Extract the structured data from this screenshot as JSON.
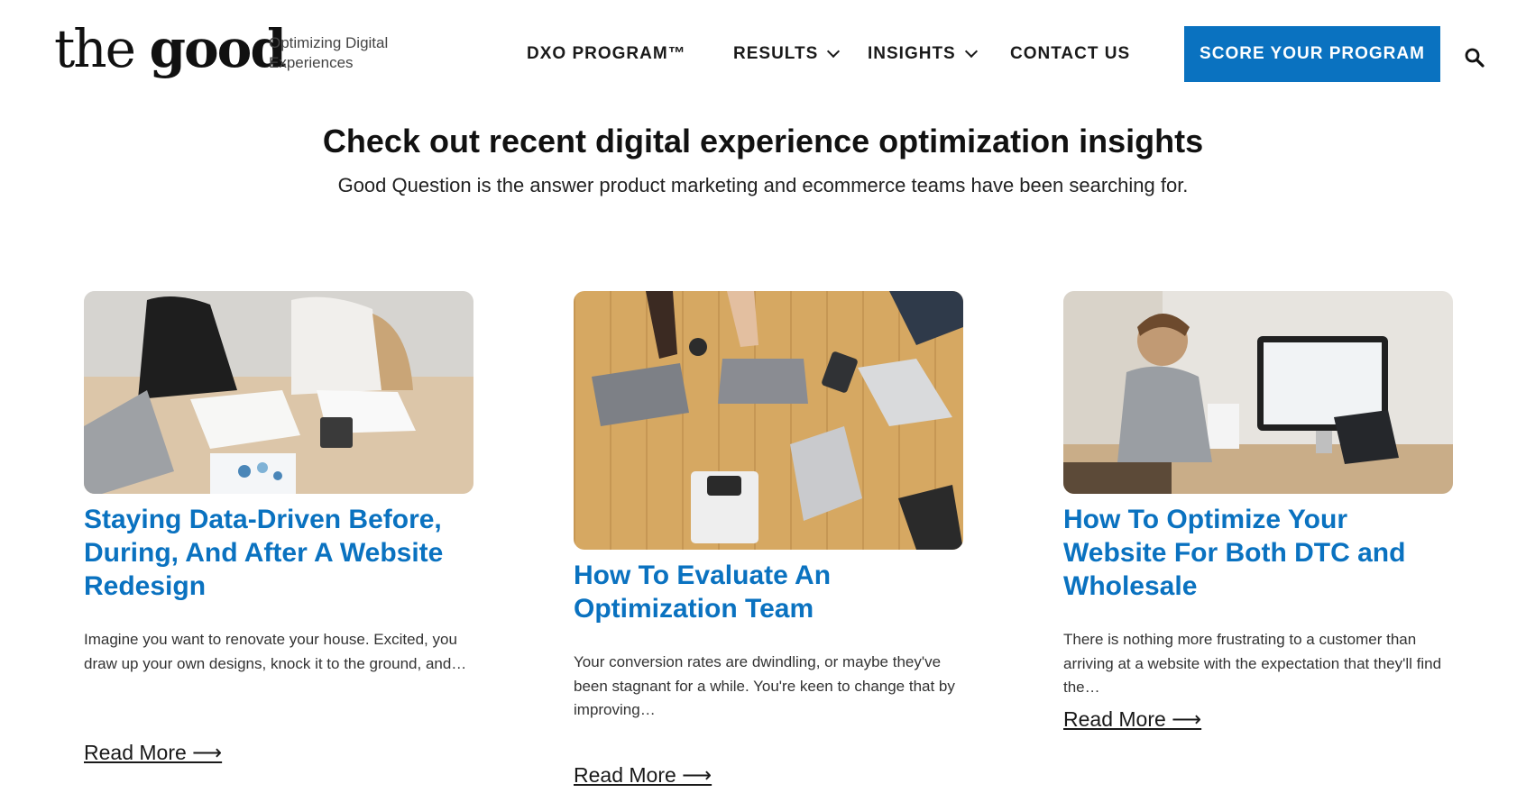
{
  "brand": {
    "logo_light": "the ",
    "logo_bold": "good",
    "tagline": "Optimizing Digital Experiences"
  },
  "nav": {
    "items": [
      {
        "label": "DXO PROGRAM™",
        "dropdown": false
      },
      {
        "label": "RESULTS",
        "dropdown": true
      },
      {
        "label": "INSIGHTS",
        "dropdown": true
      },
      {
        "label": "CONTACT US",
        "dropdown": false
      }
    ],
    "cta": "SCORE YOUR PROGRAM",
    "search_icon": "search-icon"
  },
  "intro": {
    "headline": "Check out recent digital experience optimization insights",
    "subhead": "Good Question is the answer product marketing and ecommerce teams have been searching for."
  },
  "cards": [
    {
      "title": "Staying Data-Driven Before, During, And After A Website Redesign",
      "excerpt": "Imagine you want to renovate your house. Excited, you draw up your own designs, knock it to the ground, and…",
      "read_more": "Read More ⟶"
    },
    {
      "title": "How To Evaluate An Optimization Team",
      "excerpt": "Your conversion rates are dwindling, or maybe they've been stagnant for a while. You're keen to change that by improving…",
      "read_more": "Read More ⟶"
    },
    {
      "title": "How To Optimize Your Website For Both DTC and Wholesale",
      "excerpt": "There is nothing more frustrating to a customer than arriving at a website with the expectation that they'll find the…",
      "read_more": "Read More ⟶"
    }
  ],
  "colors": {
    "accent": "#0a72c0",
    "text": "#1a1a1a"
  }
}
